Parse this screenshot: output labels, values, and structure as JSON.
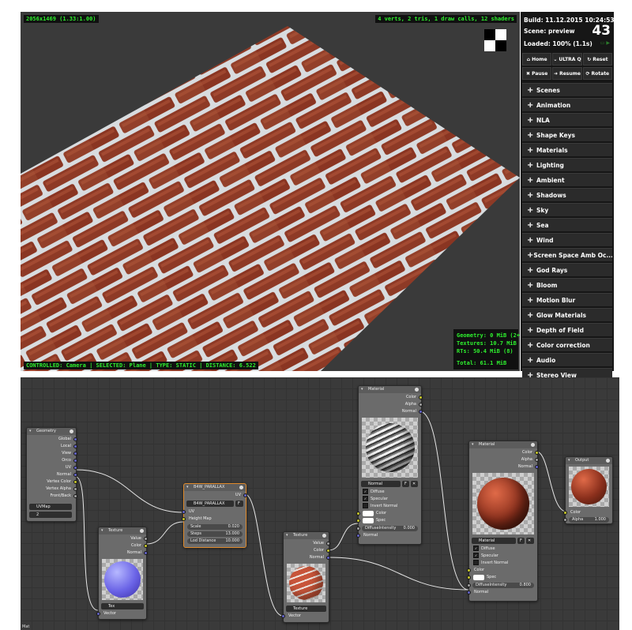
{
  "viewport": {
    "resolution": "2056x1469 (1.33:1.00)",
    "stats": "4 verts, 2 tris, 1 draw calls, 12 shaders",
    "status": "CONTROLLED: Camera | SELECTED: Plane | TYPE: STATIC | DISTANCE: 6.522",
    "memory": {
      "geometry": "Geometry: 0 MiB (2+2)",
      "textures": "Textures: 10.7 MiB (2)",
      "rts": "RTs: 50.4 MiB (8)",
      "total": "Total: 61.1 MiB"
    }
  },
  "panel": {
    "build": "Build:  11.12.2015 10:24:53",
    "scene": "Scene:  preview",
    "loaded": "Loaded:  100% (1.1s)",
    "fps": "43",
    "buttons_row1": [
      {
        "icon": "home-icon",
        "glyph": "⌂",
        "label": "Home"
      },
      {
        "icon": "chevron-down-icon",
        "glyph": "⌄",
        "label": "ULTRA Q"
      },
      {
        "icon": "reset-icon",
        "glyph": "↻",
        "label": "Reset"
      }
    ],
    "buttons_row2": [
      {
        "icon": "pause-icon",
        "glyph": "✖",
        "label": "Pause"
      },
      {
        "icon": "resume-icon",
        "glyph": "➜",
        "label": "Resume"
      },
      {
        "icon": "rotate-icon",
        "glyph": "⟳",
        "label": "Rotate"
      }
    ],
    "menu": [
      "Scenes",
      "Animation",
      "NLA",
      "Shape Keys",
      "Materials",
      "Lighting",
      "Ambient",
      "Shadows",
      "Sky",
      "Sea",
      "Wind",
      "Screen Space Amb Oc...",
      "God Rays",
      "Bloom",
      "Motion Blur",
      "Glow Materials",
      "Depth of Field",
      "Color correction",
      "Audio",
      "Stereo View"
    ]
  },
  "nodes": {
    "geometry": {
      "title": "Geometry",
      "outputs": [
        "Global",
        "Local",
        "View",
        "Orco",
        "UV",
        "Normal",
        "Vertex Color",
        "Vertex Alpha",
        "Front/Back"
      ],
      "uvmap": "UVMap",
      "field2": "2"
    },
    "texture1": {
      "title": "Texture",
      "outputs": [
        "Value",
        "Color",
        "Normal"
      ],
      "texture": "Tex",
      "input": "Vector"
    },
    "parallax": {
      "title": "B4W_PARALLAX",
      "output": "UV",
      "group": "B4W_PARALLAX",
      "group_user": "F",
      "inputs": [
        "UV",
        "Height Map"
      ],
      "fields": [
        {
          "label": "Scale",
          "value": "0.020"
        },
        {
          "label": "Steps",
          "value": "13.000"
        },
        {
          "label": "Lod Distance",
          "value": "10.000"
        }
      ]
    },
    "texture2": {
      "title": "Texture",
      "outputs": [
        "Value",
        "Color",
        "Normal"
      ],
      "texture": "Texture",
      "input": "Vector"
    },
    "material1": {
      "title": "Material",
      "outputs": [
        "Color",
        "Alpha",
        "Normal"
      ],
      "material": "Normal",
      "user": "F",
      "checks": [
        "Diffuse",
        "Specular",
        "Invert Normal"
      ],
      "inputs": [
        "Color",
        "Spec"
      ],
      "diffuse_intensity": {
        "label": "DiffuseIntensity",
        "value": "0.000"
      },
      "normal": "Normal"
    },
    "material2": {
      "title": "Material",
      "outputs": [
        "Color",
        "Alpha",
        "Normal"
      ],
      "material": "Material",
      "user": "F",
      "checks": [
        "Diffuse",
        "Specular",
        "Invert Normal"
      ],
      "inputs": [
        "Color",
        "Spec"
      ],
      "diffuse_intensity": {
        "label": "DiffuseIntensity",
        "value": "0.800"
      },
      "normal": "Normal"
    },
    "output": {
      "title": "Output",
      "inputs": [
        "Color"
      ],
      "alpha": {
        "label": "Alpha",
        "value": "1.000"
      }
    }
  },
  "editor_label": "Mat"
}
